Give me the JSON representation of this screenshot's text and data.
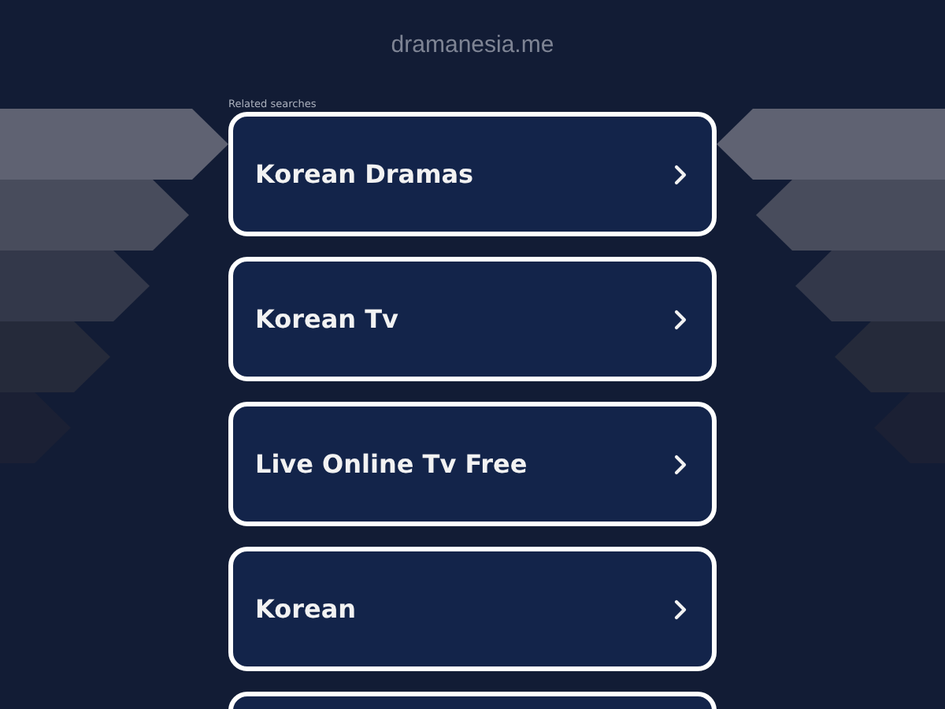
{
  "domain": "dramanesia.me",
  "related_label": "Related searches",
  "results": [
    {
      "label": "Korean Dramas"
    },
    {
      "label": "Korean Tv"
    },
    {
      "label": "Live Online Tv Free"
    },
    {
      "label": "Korean"
    }
  ]
}
